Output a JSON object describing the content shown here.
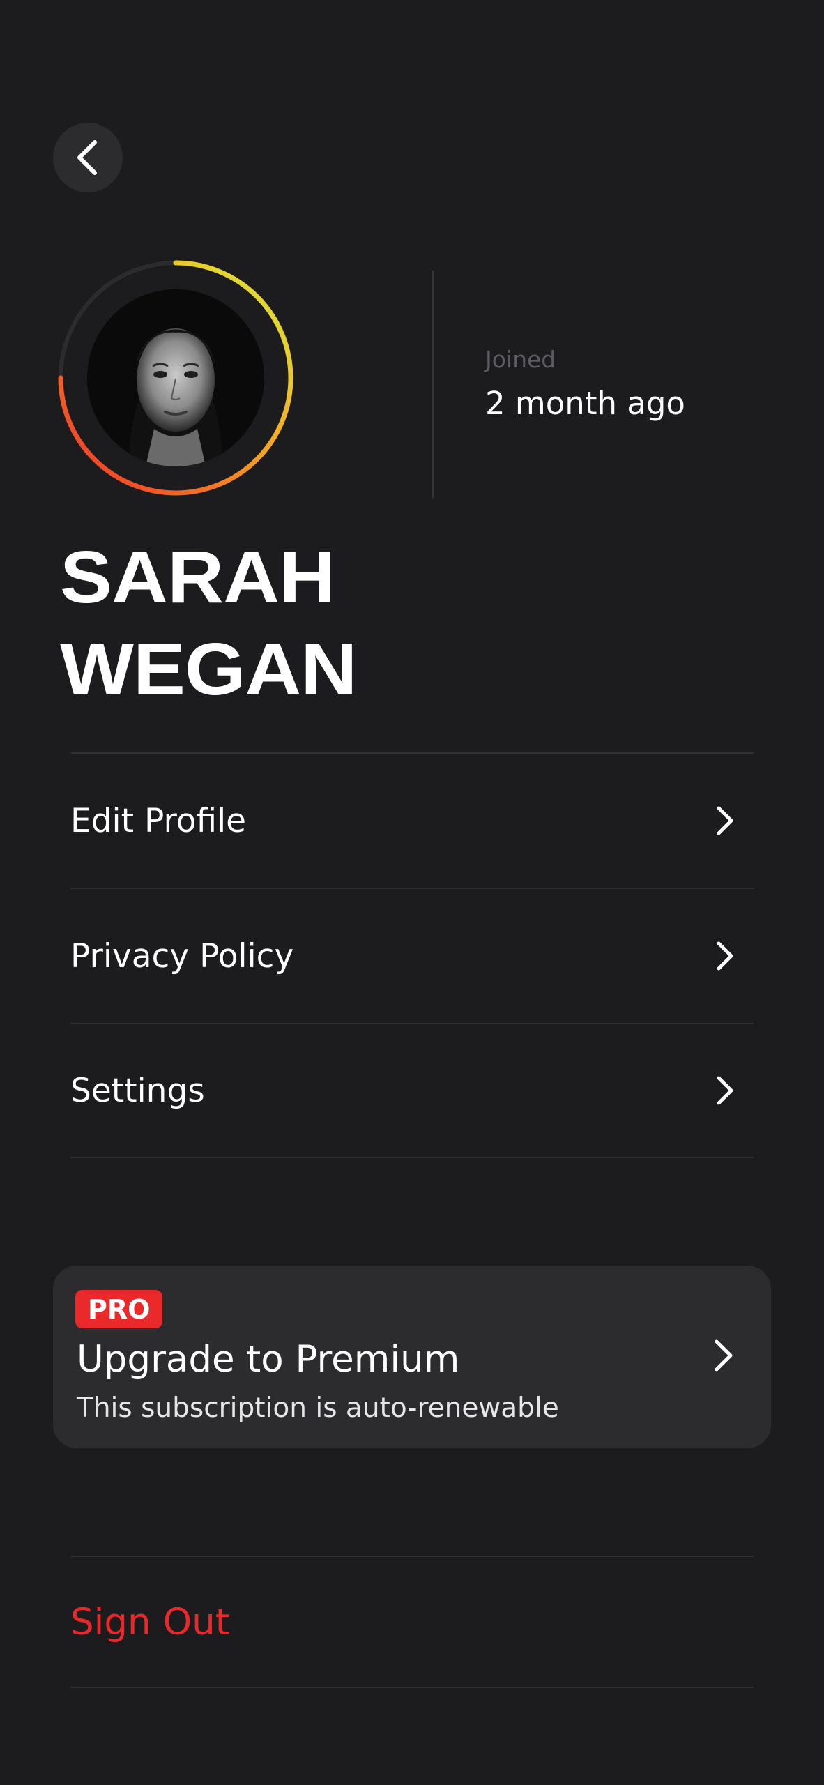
{
  "header": {
    "back_icon": "chevron-left-icon"
  },
  "profile": {
    "name_line1": "SARAH",
    "name_line2": "WEGAN",
    "joined_label": "Joined",
    "joined_value": "2 month ago",
    "ring_colors": [
      "#d9f03c",
      "#f5a623",
      "#ee2b2b"
    ]
  },
  "menu": {
    "items": [
      {
        "label": "Edit Profile",
        "icon": "chevron-right-icon"
      },
      {
        "label": "Privacy Policy",
        "icon": "chevron-right-icon"
      },
      {
        "label": "Settings",
        "icon": "chevron-right-icon"
      }
    ]
  },
  "premium": {
    "badge": "PRO",
    "title": "Upgrade to Premium",
    "subtitle": "This subscription is auto-renewable",
    "icon": "chevron-right-icon",
    "badge_color": "#ea2a2a"
  },
  "sign_out": {
    "label": "Sign Out",
    "color": "#e8282b"
  },
  "theme": {
    "background": "#1c1c1e",
    "card": "#2c2c2e"
  }
}
